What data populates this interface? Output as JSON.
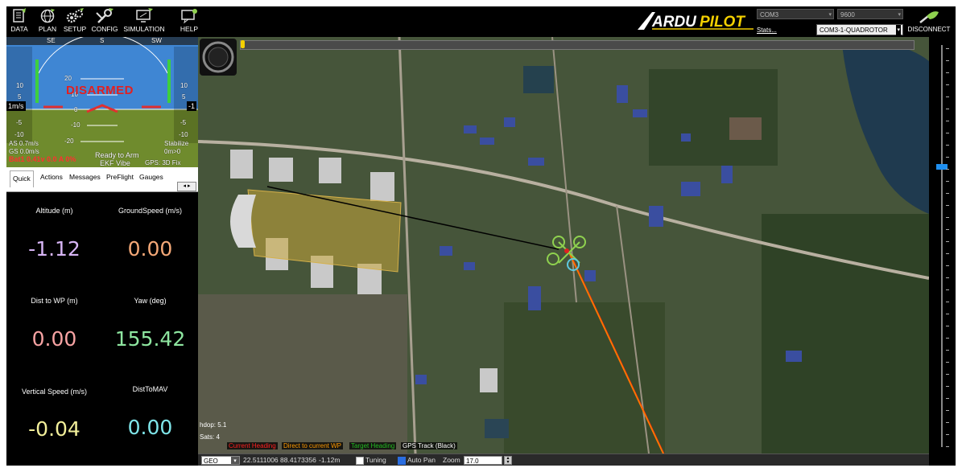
{
  "toolbar": {
    "buttons": [
      {
        "label": "DATA",
        "icon": "data-icon"
      },
      {
        "label": "PLAN",
        "icon": "plan-globe-icon"
      },
      {
        "label": "SETUP",
        "icon": "setup-gears-icon"
      },
      {
        "label": "CONFIG",
        "icon": "config-wrench-icon"
      },
      {
        "label": "SIMULATION",
        "icon": "simulation-monitor-icon"
      },
      {
        "label": "HELP",
        "icon": "help-icon"
      }
    ],
    "logo_text": "ARDUPILOT",
    "port": "COM3",
    "baud": "9600",
    "stats": "Stats...",
    "vehicle": "COM3-1-QUADROTOR",
    "disconnect": "DISCONNECT"
  },
  "hud": {
    "status": "DISARMED",
    "speed_box": "1m/s",
    "airspeed": "AS 0.7m/s",
    "groundspeed": "GS 0.0m/s",
    "ready": "Ready to Arm",
    "ekf": "EKF Vibe",
    "gps": "GPS: 3D Fix",
    "mode": "Stabilize",
    "dist": "0m>0",
    "battery": "Bat1 0.41v 0.0 A 0%",
    "alt_box": "-1",
    "pitch_labels": [
      "20",
      "10",
      "0",
      "-10",
      "-20"
    ],
    "left_scale": [
      "10",
      "5",
      "-5",
      "-10"
    ],
    "right_scale": [
      "10",
      "5",
      "-5",
      "-10"
    ],
    "heading_labels": [
      "SE",
      "S",
      "SW"
    ]
  },
  "tabs": [
    "Quick",
    "Actions",
    "Messages",
    "PreFlight",
    "Gauges"
  ],
  "quick": [
    {
      "label": "Altitude (m)",
      "value": "-1.12",
      "color": "#d7b5f5"
    },
    {
      "label": "GroundSpeed (m/s)",
      "value": "0.00",
      "color": "#f5a978"
    },
    {
      "label": "Dist to WP (m)",
      "value": "0.00",
      "color": "#f7a3a3"
    },
    {
      "label": "Yaw (deg)",
      "value": "155.42",
      "color": "#8ee6a0"
    },
    {
      "label": "Vertical Speed (m/s)",
      "value": "-0.04",
      "color": "#f2ef9a"
    },
    {
      "label": "DistToMAV",
      "value": "0.00",
      "color": "#7fe6ea"
    }
  ],
  "map": {
    "hdop": "hdop: 5.1",
    "sats": "Sats: 4",
    "legend": [
      {
        "label": "Current Heading",
        "color": "#ff2020"
      },
      {
        "label": "Direct to current WP",
        "color": "#ff9a00"
      },
      {
        "label": "Target Heading",
        "color": "#22bb22"
      },
      {
        "label": "GPS Track (Black)",
        "color": "#ffffff"
      }
    ]
  },
  "statusbar": {
    "coord_mode": "GEO",
    "coords": "22.5111006 88.4173356",
    "alt": "-1.12m",
    "tuning": "Tuning",
    "autopan": "Auto Pan",
    "autopan_checked": true,
    "zoom_label": "Zoom",
    "zoom_value": "17.0"
  }
}
